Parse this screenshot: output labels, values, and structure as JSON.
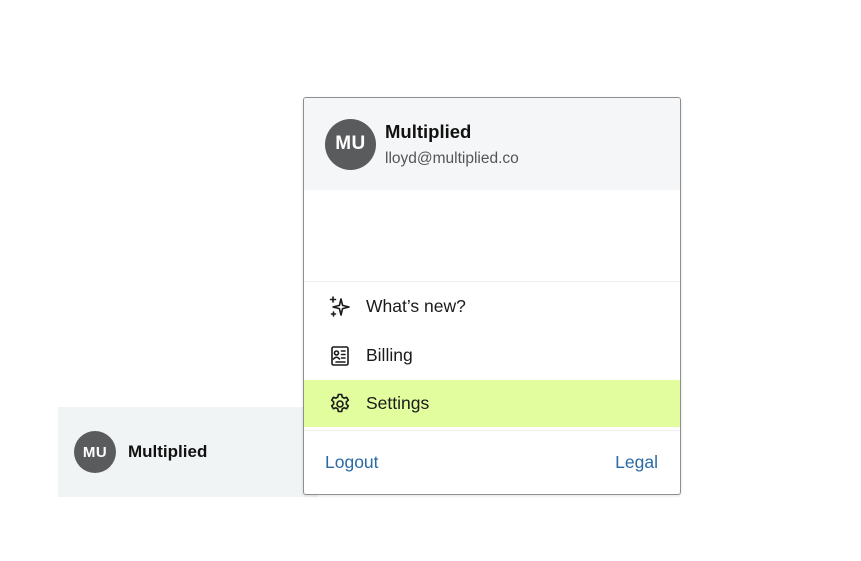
{
  "account_bar": {
    "avatar_initials": "MU",
    "name": "Multiplied"
  },
  "menu": {
    "header": {
      "avatar_initials": "MU",
      "title": "Multiplied",
      "email": "lloyd@multiplied.co"
    },
    "items": [
      {
        "label": "What’s new?",
        "icon": "sparkles-icon",
        "active": false
      },
      {
        "label": "Billing",
        "icon": "billing-icon",
        "active": false
      },
      {
        "label": "Settings",
        "icon": "gear-icon",
        "active": true
      }
    ],
    "footer": {
      "logout_label": "Logout",
      "legal_label": "Legal"
    }
  },
  "colors": {
    "avatar_bg": "#5a5b5d",
    "active_item_bg": "#e1fd9e",
    "link": "#2a6aa6",
    "header_bg": "#f5f6f7",
    "account_bar_bg": "#f1f4f5"
  }
}
